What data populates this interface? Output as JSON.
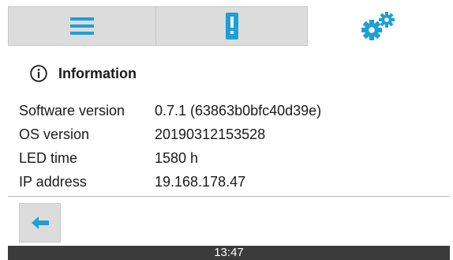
{
  "tabs": [
    {
      "name": "menu",
      "icon": "menu-icon",
      "color": "#1e9fd6",
      "active": false
    },
    {
      "name": "alert",
      "icon": "alert-icon",
      "color": "#1e9fd6",
      "active": false
    },
    {
      "name": "settings",
      "icon": "gears-icon",
      "color": "#1e9fd6",
      "active": true
    }
  ],
  "info": {
    "icon": "info-icon",
    "title": "Information",
    "rows": [
      {
        "label": "Software version",
        "value": "0.7.1 (63863b0bfc40d39e)"
      },
      {
        "label": "OS version",
        "value": "20190312153528"
      },
      {
        "label": "LED time",
        "value": "1580 h"
      },
      {
        "label": "IP address",
        "value": "19.168.178.47"
      }
    ]
  },
  "footer": {
    "back_icon": "back-arrow-icon"
  },
  "status": {
    "time": "13:47"
  },
  "colors": {
    "accent": "#1e9fd6",
    "tab_inactive": "#dcdcdc",
    "statusbar": "#3b3b3b"
  }
}
